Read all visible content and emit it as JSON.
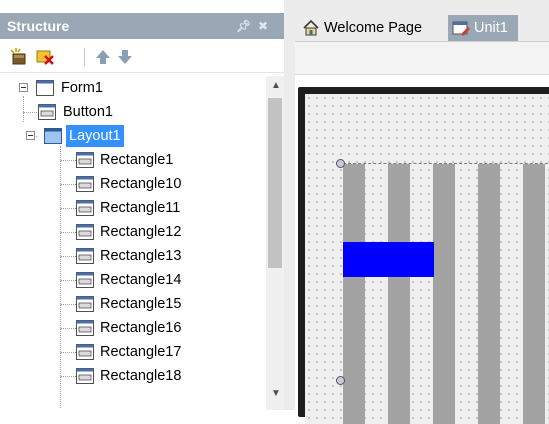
{
  "structure_panel": {
    "title": "Structure",
    "pin_icon": "pin-icon",
    "close_icon": "close-icon",
    "toolbar": [
      "add-component-icon",
      "delete-component-icon",
      "move-up-icon",
      "move-down-icon"
    ]
  },
  "tree": {
    "root": "Form1",
    "children": [
      "Button1"
    ],
    "selected": "Layout1",
    "layout_children": [
      "Rectangle1",
      "Rectangle10",
      "Rectangle11",
      "Rectangle12",
      "Rectangle13",
      "Rectangle14",
      "Rectangle15",
      "Rectangle16",
      "Rectangle17",
      "Rectangle18"
    ]
  },
  "tabs": [
    {
      "label": "Welcome Page",
      "icon": "home-icon",
      "active": false
    },
    {
      "label": "Unit1",
      "icon": "unit-form-icon",
      "active": true
    }
  ],
  "colors": {
    "selection": "#3392ff",
    "panel_header": "#9aa7b5",
    "blue_rectangle": "#0000ff",
    "stripe": "#a3a3a3"
  }
}
